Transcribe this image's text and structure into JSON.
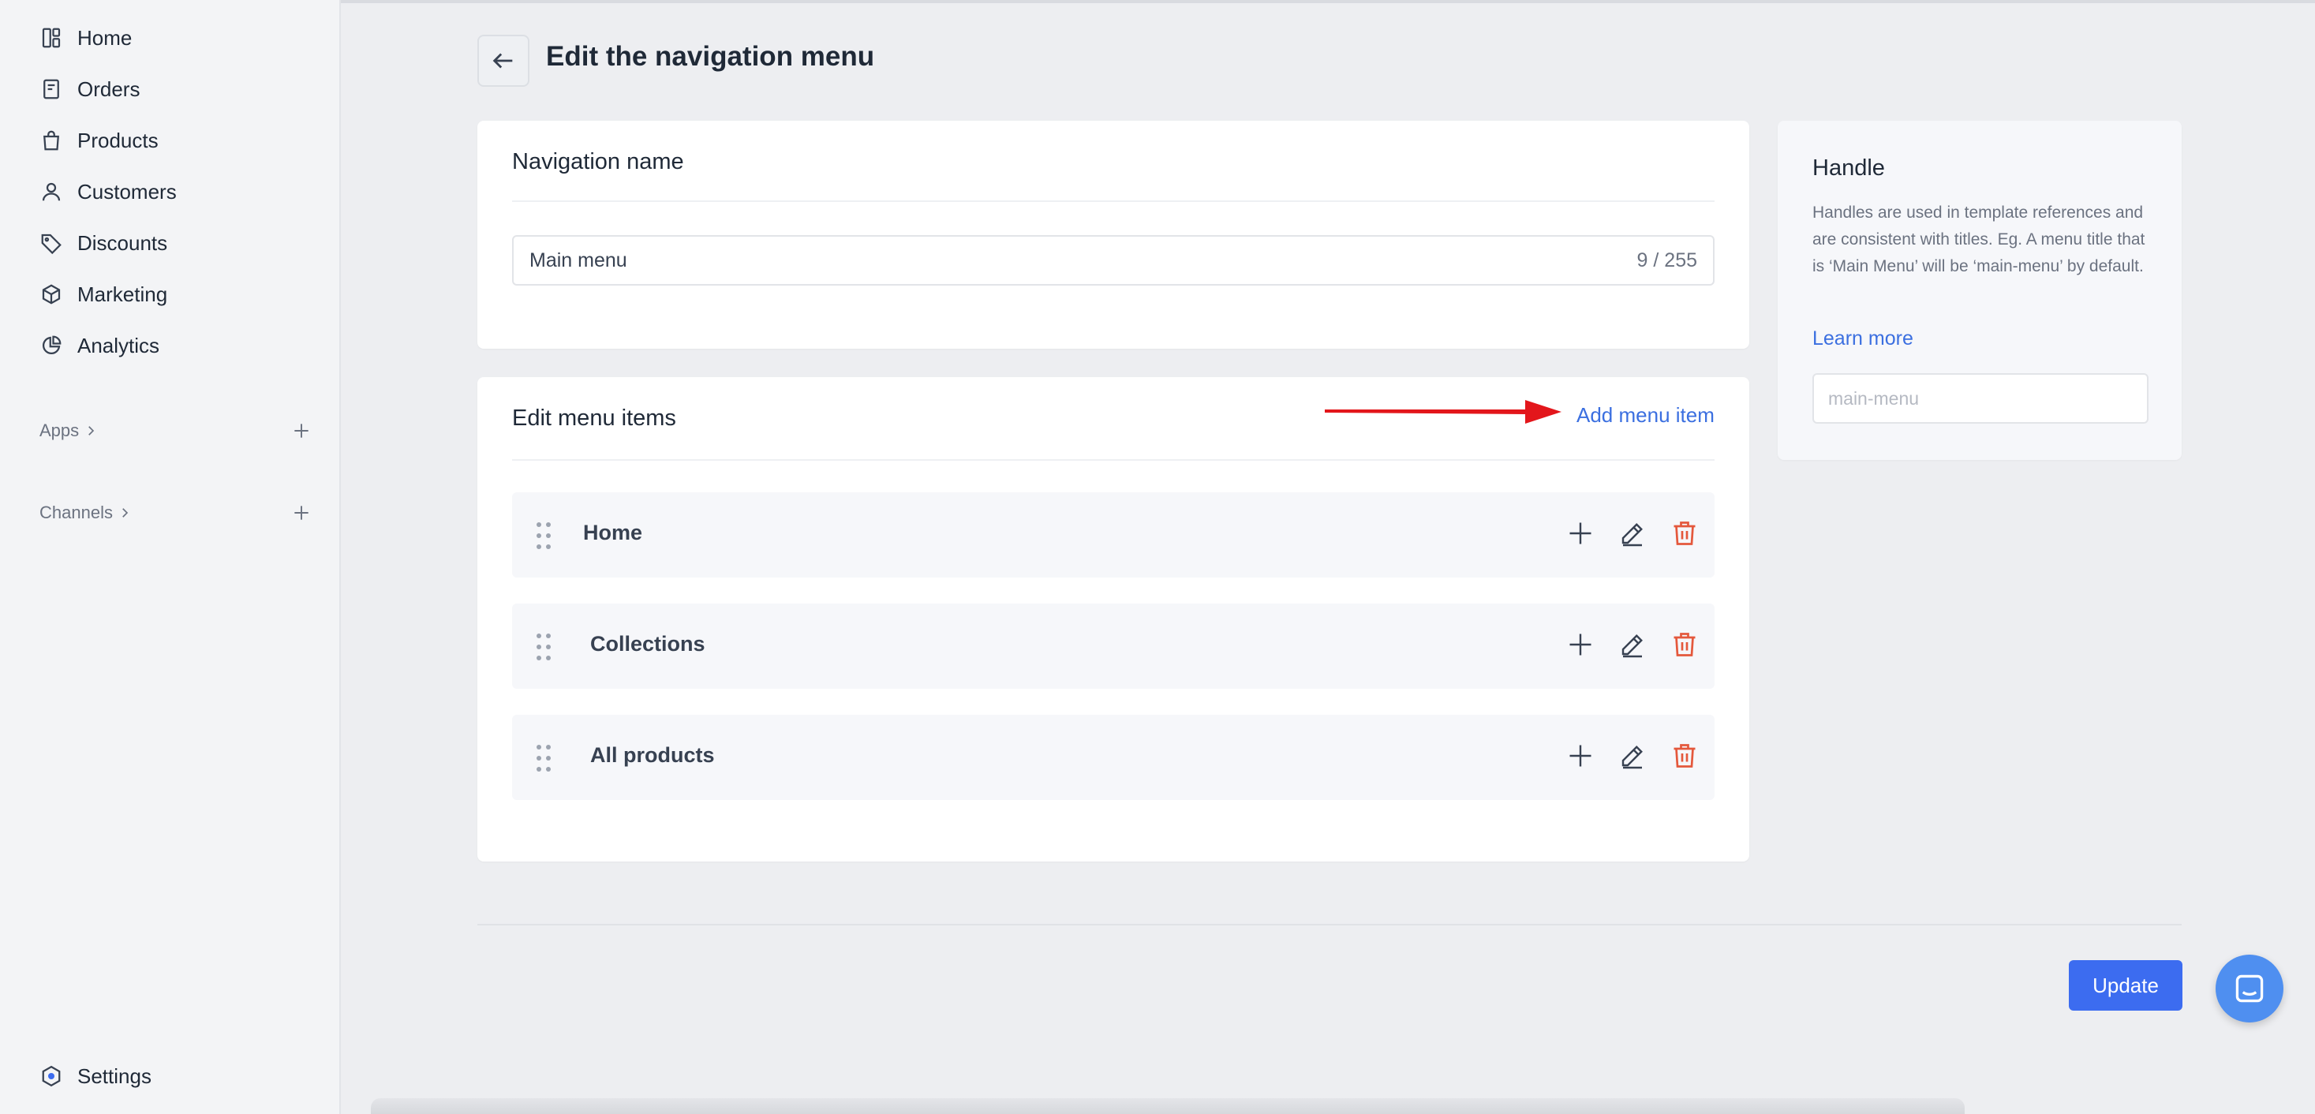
{
  "sidebar": {
    "items": [
      {
        "label": "Home",
        "icon": "dashboard-icon"
      },
      {
        "label": "Orders",
        "icon": "orders-icon"
      },
      {
        "label": "Products",
        "icon": "bag-icon"
      },
      {
        "label": "Customers",
        "icon": "user-icon"
      },
      {
        "label": "Discounts",
        "icon": "tag-icon"
      },
      {
        "label": "Marketing",
        "icon": "cube-icon"
      },
      {
        "label": "Analytics",
        "icon": "pie-chart-icon"
      }
    ],
    "apps_label": "Apps",
    "channels_label": "Channels",
    "settings_label": "Settings"
  },
  "header": {
    "title": "Edit the navigation menu"
  },
  "navigation_name": {
    "title": "Navigation name",
    "value": "Main menu",
    "counter": "9 / 255"
  },
  "menu_items": {
    "title": "Edit menu items",
    "add_label": "Add menu item",
    "items": [
      {
        "label": "Home"
      },
      {
        "label": "Collections"
      },
      {
        "label": "All products"
      }
    ]
  },
  "handle": {
    "title": "Handle",
    "description": "Handles are used in template references and are consistent with titles. Eg. A menu title that is ‘Main Menu’ will be ‘main-menu’ by default.",
    "learn_more": "Learn more",
    "placeholder": "main-menu"
  },
  "footer": {
    "update_label": "Update"
  },
  "colors": {
    "accent": "#3c6cf0",
    "link": "#3b6fe0",
    "danger": "#e4583c",
    "annotation_arrow": "#e3161b"
  }
}
